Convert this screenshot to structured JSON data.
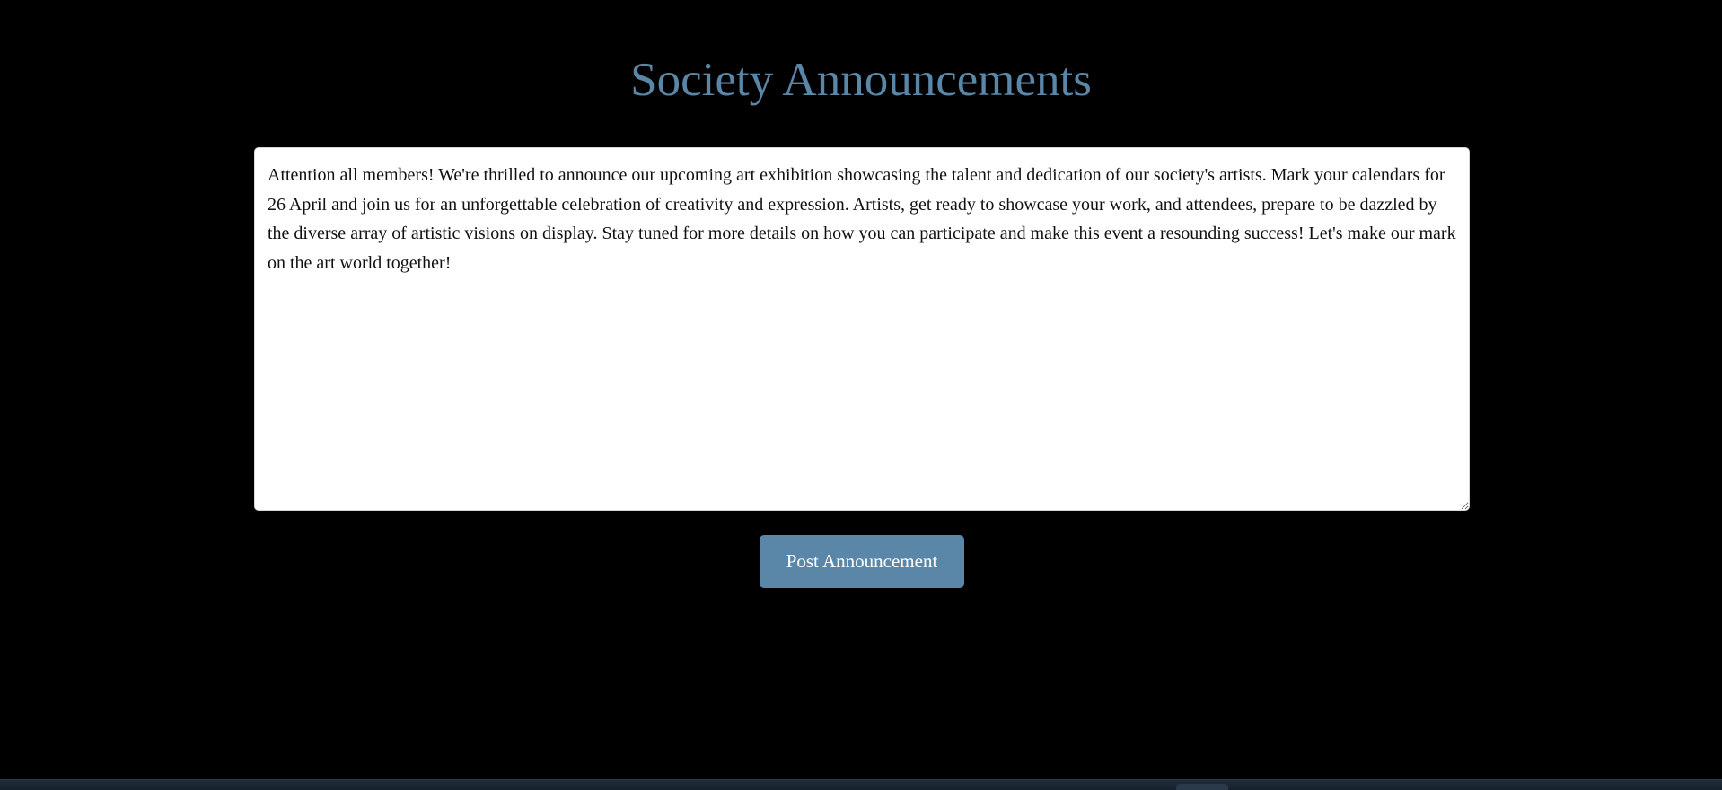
{
  "page": {
    "title": "Society Announcements"
  },
  "announcement": {
    "text": "Attention all members! We're thrilled to announce our upcoming art exhibition showcasing the talent and dedication of our society's artists. Mark your calendars for 26 April and join us for an unforgettable celebration of creativity and expression. Artists, get ready to showcase your work, and attendees, prepare to be dazzled by the diverse array of artistic visions on display. Stay tuned for more details on how you can participate and make this event a resounding success! Let's make our mark on the art world together!"
  },
  "actions": {
    "post_label": "Post Announcement"
  },
  "colors": {
    "background": "#000000",
    "title": "#5a87a8",
    "button": "#5a87a8",
    "button_text": "#ffffff"
  }
}
